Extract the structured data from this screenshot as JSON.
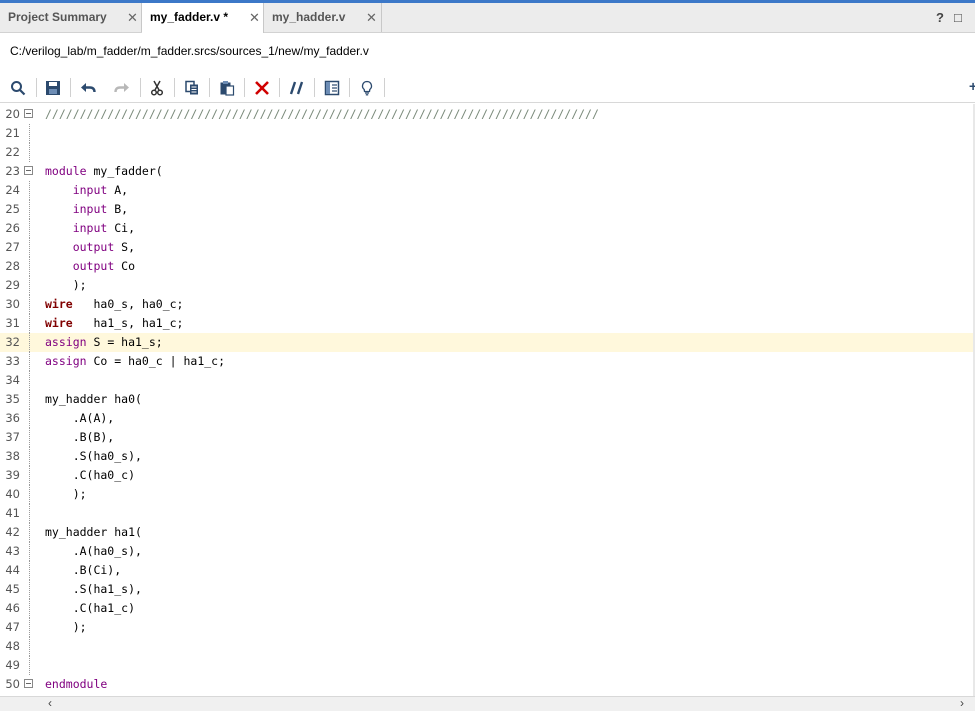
{
  "tabs": [
    {
      "label": "Project Summary",
      "active": false
    },
    {
      "label": "my_fadder.v *",
      "active": true
    },
    {
      "label": "my_hadder.v",
      "active": false
    }
  ],
  "tabbar_right": {
    "help": "?",
    "restore": "□"
  },
  "file_path": "C:/verilog_lab/m_fadder/m_fadder.srcs/sources_1/new/my_fadder.v",
  "toolbar_icons": [
    "search-icon",
    "save-icon",
    "undo-icon",
    "redo-icon",
    "cut-icon",
    "copy-icon",
    "paste-icon",
    "delete-icon",
    "comment-toggle-icon",
    "split-view-icon",
    "lightbulb-icon"
  ],
  "colors": {
    "keyword": "#800080",
    "wire_keyword": "#800000",
    "highlight_line": "#fff8dc",
    "delete_icon": "#d00000",
    "accent": "#3c78c8"
  },
  "highlighted_line": 32,
  "lines": [
    {
      "n": "20",
      "text": "////////////////////////////////////////////////////////////////////////////////",
      "fold": true
    },
    {
      "n": "21",
      "text": ""
    },
    {
      "n": "22",
      "text": ""
    },
    {
      "n": "23",
      "text": "module my_fadder(",
      "fold": true
    },
    {
      "n": "24",
      "text": "    input A,"
    },
    {
      "n": "25",
      "text": "    input B,"
    },
    {
      "n": "26",
      "text": "    input Ci,"
    },
    {
      "n": "27",
      "text": "    output S,"
    },
    {
      "n": "28",
      "text": "    output Co"
    },
    {
      "n": "29",
      "text": "    );"
    },
    {
      "n": "30",
      "text": "wire   ha0_s, ha0_c;"
    },
    {
      "n": "31",
      "text": "wire   ha1_s, ha1_c;"
    },
    {
      "n": "32",
      "text": "assign S = ha1_s;"
    },
    {
      "n": "33",
      "text": "assign Co = ha0_c | ha1_c;"
    },
    {
      "n": "34",
      "text": ""
    },
    {
      "n": "35",
      "text": "my_hadder ha0("
    },
    {
      "n": "36",
      "text": "    .A(A),"
    },
    {
      "n": "37",
      "text": "    .B(B),"
    },
    {
      "n": "38",
      "text": "    .S(ha0_s),"
    },
    {
      "n": "39",
      "text": "    .C(ha0_c)"
    },
    {
      "n": "40",
      "text": "    );"
    },
    {
      "n": "41",
      "text": ""
    },
    {
      "n": "42",
      "text": "my_hadder ha1("
    },
    {
      "n": "43",
      "text": "    .A(ha0_s),"
    },
    {
      "n": "44",
      "text": "    .B(Ci),"
    },
    {
      "n": "45",
      "text": "    .S(ha1_s),"
    },
    {
      "n": "46",
      "text": "    .C(ha1_c)"
    },
    {
      "n": "47",
      "text": "    );"
    },
    {
      "n": "48",
      "text": ""
    },
    {
      "n": "49",
      "text": ""
    },
    {
      "n": "50",
      "text": "endmodule",
      "fold": true
    }
  ]
}
